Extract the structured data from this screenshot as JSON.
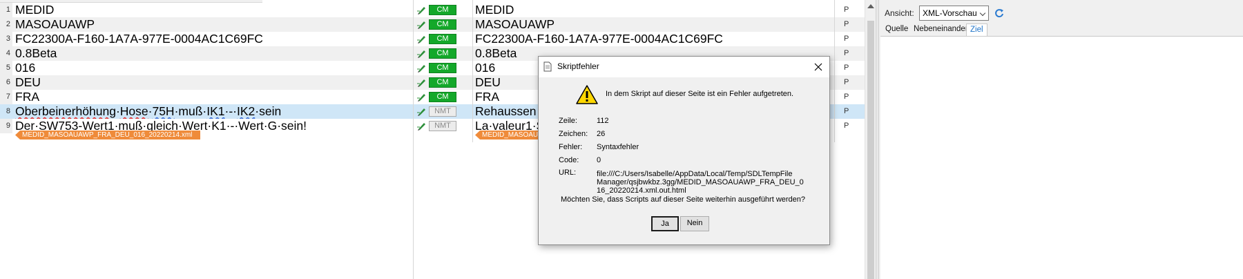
{
  "editor": {
    "segments": [
      {
        "num": "1",
        "source": "MEDID",
        "status": "CM",
        "target": "MEDID",
        "lock": "P"
      },
      {
        "num": "2",
        "source": "MASOAUAWP",
        "status": "CM",
        "target": "MASOAUAWP",
        "lock": "P"
      },
      {
        "num": "3",
        "source": "FC22300A-F160-1A7A-977E-0004AC1C69FC",
        "status": "CM",
        "target": "FC22300A-F160-1A7A-977E-0004AC1C69FC",
        "lock": "P"
      },
      {
        "num": "4",
        "source": "0.8Beta",
        "status": "CM",
        "target": "0.8Beta",
        "lock": "P"
      },
      {
        "num": "5",
        "source": "016",
        "status": "CM",
        "target": "016",
        "lock": "P"
      },
      {
        "num": "6",
        "source": "DEU",
        "status": "CM",
        "target": "DEU",
        "lock": "P"
      },
      {
        "num": "7",
        "source": "FRA",
        "status": "CM",
        "target": "FRA",
        "lock": "P"
      },
      {
        "num": "8",
        "source_parts": [
          "Oberbeinerhöhung",
          "·",
          "Hose",
          "·",
          "75H",
          "·muß·",
          "IK1",
          "·-·",
          "IK2",
          "·sein"
        ],
        "status": "NMT",
        "target": "Rehaussen",
        "lock": "P"
      },
      {
        "num": "9",
        "source": "Der·SW753-Wert1·muß·gleich·Wert·K1·-·Wert·G·sein!",
        "status": "NMT",
        "target": "La·valeur1·S",
        "lock": "P"
      }
    ],
    "file_tag_source": "MEDID_MASOAUAWP_FRA_DEU_016_20220214.xml",
    "file_tag_target": "MEDID_MASOAUAWP"
  },
  "preview": {
    "view_label": "Ansicht:",
    "view_select": "XML-Vorschau",
    "tabs": [
      "Quelle",
      "Nebeneinander",
      "Ziel"
    ],
    "active_tab": "Ziel"
  },
  "dialog": {
    "title": "Skriptfehler",
    "message": "In dem Skript auf dieser Seite ist ein Fehler aufgetreten.",
    "fields": [
      {
        "label": "Zeile:",
        "value": "112"
      },
      {
        "label": "Zeichen:",
        "value": "26"
      },
      {
        "label": "Fehler:",
        "value": "Syntaxfehler"
      },
      {
        "label": "Code:",
        "value": "0"
      }
    ],
    "url_label": "URL:",
    "url_lines": [
      "file:///C:/Users/Isabelle/AppData/Local/Temp/SDLTempFile",
      "Manager/qsjbwkbz.3gg/MEDID_MASOAUAWP_FRA_DEU_0",
      "16_20220214.xml.out.html"
    ],
    "question": "Möchten Sie, dass Scripts auf dieser Seite weiterhin ausgeführt werden?",
    "yes_label": "Ja",
    "no_label": "Nein"
  },
  "colors": {
    "cm_badge": "#14a82a",
    "file_tag": "#ef8b3a",
    "selected_row": "#cfe6f7",
    "active_tab": "#1e73c8"
  }
}
